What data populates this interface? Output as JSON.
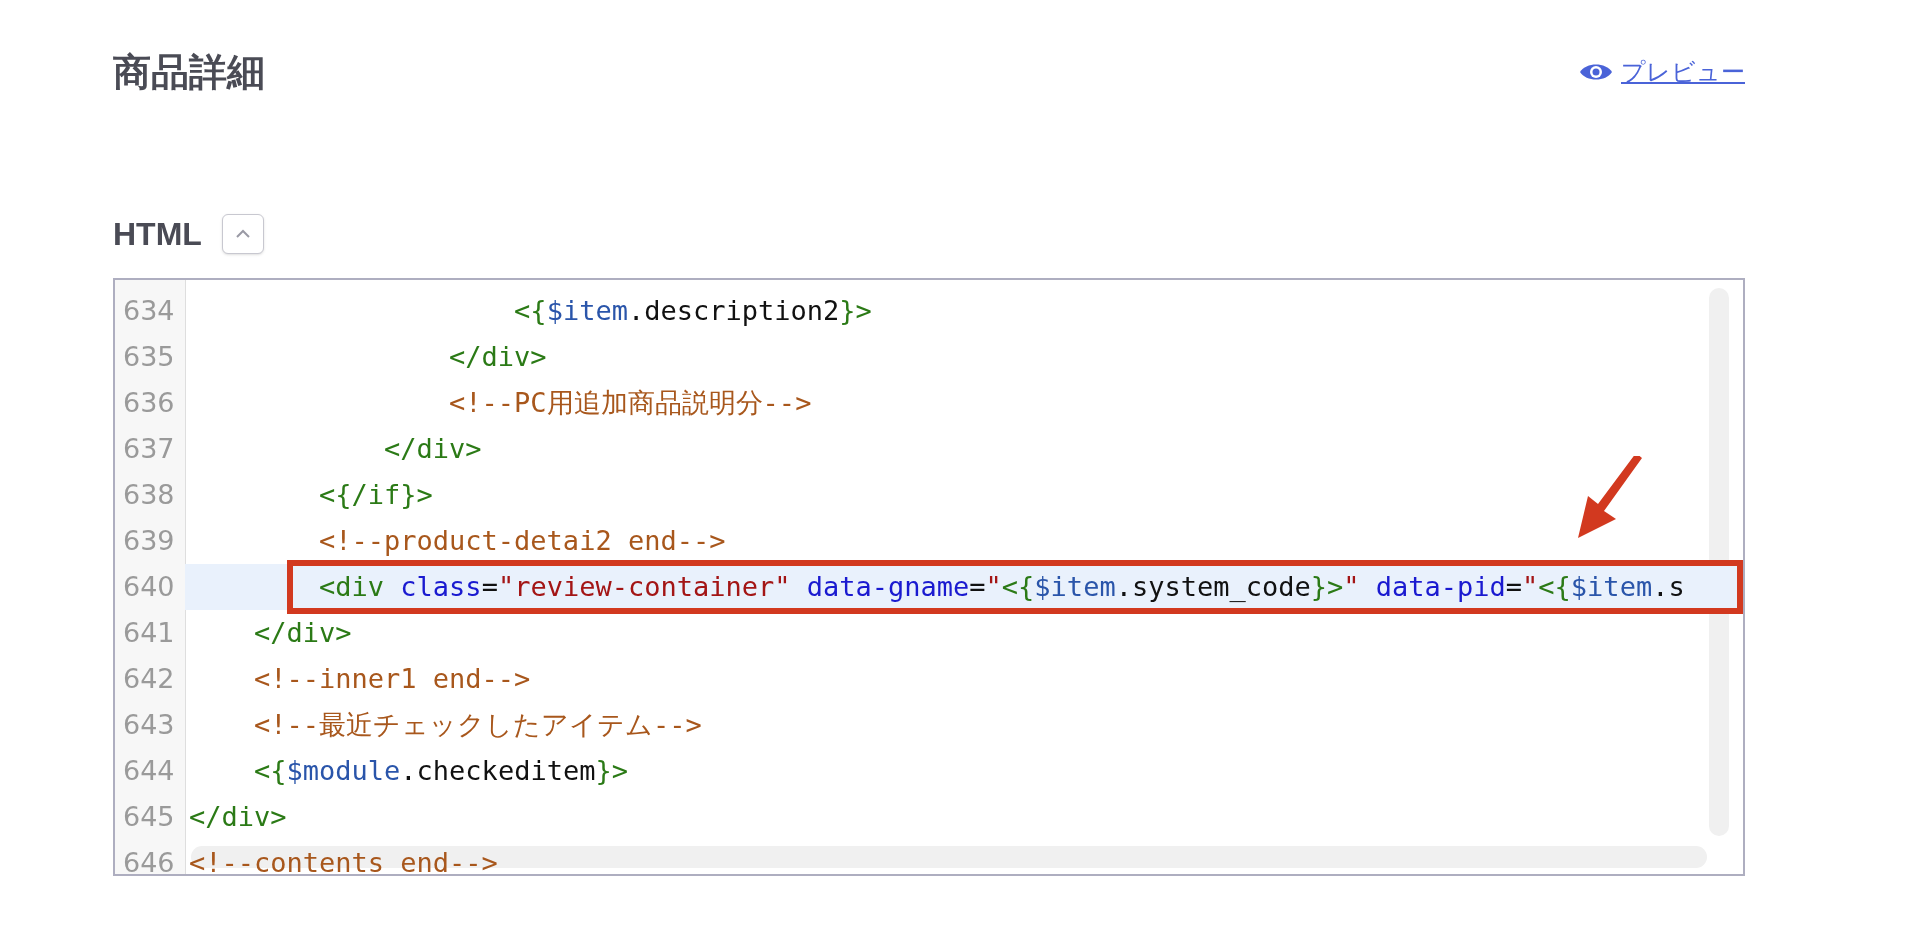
{
  "page": {
    "title": "商品詳細",
    "preview_link": "プレビュー"
  },
  "html_section": {
    "label": "HTML",
    "expanded": true
  },
  "editor": {
    "lines": [
      {
        "number": "634",
        "highlighted": false,
        "boxed": false,
        "tokens": [
          {
            "kind": "tag",
            "text": "                    <{"
          },
          {
            "kind": "var",
            "text": "$item"
          },
          {
            "kind": "text",
            "text": ".description2"
          },
          {
            "kind": "tag",
            "text": "}>"
          }
        ]
      },
      {
        "number": "635",
        "highlighted": false,
        "boxed": false,
        "tokens": [
          {
            "kind": "tag",
            "text": "                </div>"
          }
        ]
      },
      {
        "number": "636",
        "highlighted": false,
        "boxed": false,
        "tokens": [
          {
            "kind": "comment",
            "text": "                <!--PC用追加商品説明分-->"
          }
        ]
      },
      {
        "number": "637",
        "highlighted": false,
        "boxed": false,
        "tokens": [
          {
            "kind": "tag",
            "text": "            </div>"
          }
        ]
      },
      {
        "number": "638",
        "highlighted": false,
        "boxed": false,
        "tokens": [
          {
            "kind": "tag",
            "text": "        <{/if}>"
          }
        ]
      },
      {
        "number": "639",
        "highlighted": false,
        "boxed": false,
        "tokens": [
          {
            "kind": "comment",
            "text": "        <!--product-detai2 end-->"
          }
        ]
      },
      {
        "number": "640",
        "highlighted": true,
        "boxed": true,
        "tokens": [
          {
            "kind": "tag",
            "text": "        <div"
          },
          {
            "kind": "attr",
            "text": " class"
          },
          {
            "kind": "text",
            "text": "="
          },
          {
            "kind": "string",
            "text": "\"review-container\""
          },
          {
            "kind": "attr",
            "text": " data-gname"
          },
          {
            "kind": "text",
            "text": "="
          },
          {
            "kind": "string",
            "text": "\""
          },
          {
            "kind": "tag",
            "text": "<{"
          },
          {
            "kind": "var",
            "text": "$item"
          },
          {
            "kind": "text",
            "text": ".system_code"
          },
          {
            "kind": "tag",
            "text": "}>"
          },
          {
            "kind": "string",
            "text": "\""
          },
          {
            "kind": "attr",
            "text": " data-pid"
          },
          {
            "kind": "text",
            "text": "="
          },
          {
            "kind": "string",
            "text": "\""
          },
          {
            "kind": "tag",
            "text": "<{"
          },
          {
            "kind": "var",
            "text": "$item"
          },
          {
            "kind": "text",
            "text": ".s"
          }
        ]
      },
      {
        "number": "641",
        "highlighted": false,
        "boxed": false,
        "tokens": [
          {
            "kind": "tag",
            "text": "    </div>"
          }
        ]
      },
      {
        "number": "642",
        "highlighted": false,
        "boxed": false,
        "tokens": [
          {
            "kind": "comment",
            "text": "    <!--inner1 end-->"
          }
        ]
      },
      {
        "number": "643",
        "highlighted": false,
        "boxed": false,
        "tokens": [
          {
            "kind": "comment",
            "text": "    <!--最近チェックしたアイテム-->"
          }
        ]
      },
      {
        "number": "644",
        "highlighted": false,
        "boxed": false,
        "tokens": [
          {
            "kind": "tag",
            "text": "    <{"
          },
          {
            "kind": "var",
            "text": "$module"
          },
          {
            "kind": "text",
            "text": ".checkeditem"
          },
          {
            "kind": "tag",
            "text": "}>"
          }
        ]
      },
      {
        "number": "645",
        "highlighted": false,
        "boxed": false,
        "tokens": [
          {
            "kind": "tag",
            "text": "</div>"
          }
        ]
      },
      {
        "number": "646",
        "highlighted": false,
        "boxed": false,
        "tokens": [
          {
            "kind": "comment",
            "text": "<!--contents end-->"
          }
        ]
      }
    ]
  }
}
